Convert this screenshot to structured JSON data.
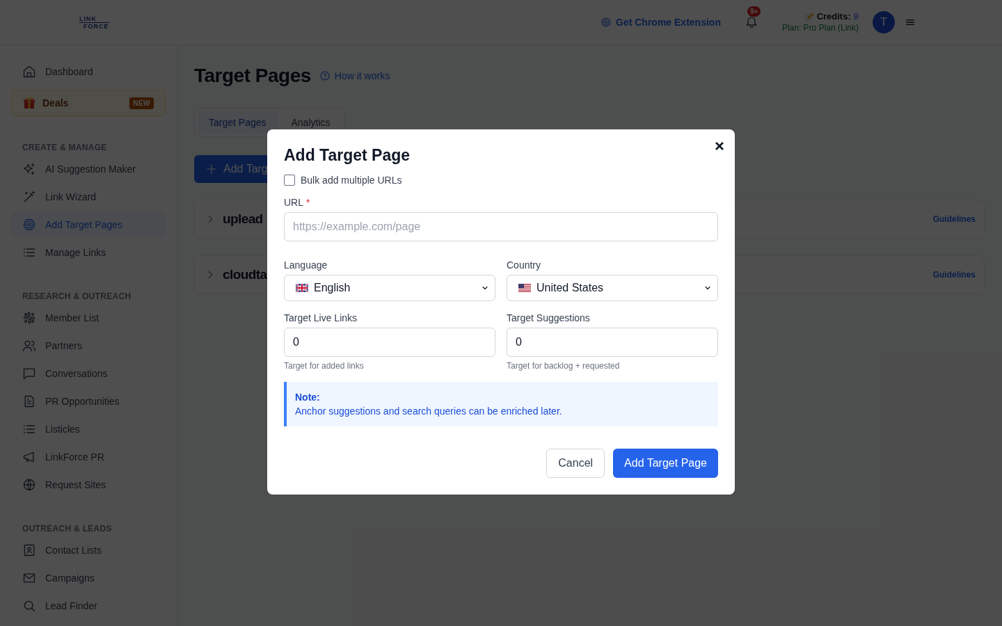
{
  "header": {
    "logo": {
      "line_1": "LINK",
      "line_2": "FORCE"
    },
    "extension_link": "Get Chrome Extension",
    "notifications": {
      "badge": "9+"
    },
    "credits": {
      "label": "Credits:",
      "value": "8"
    },
    "plan": "Plan: Pro Plan (Link)",
    "avatar": "T"
  },
  "sidebar": {
    "dashboard": {
      "label": "Dashboard",
      "selected": false
    },
    "deals": {
      "label": "Deals",
      "badge": "NEW"
    },
    "sections": [
      {
        "title": "CREATE & MANAGE",
        "items": [
          {
            "label": "AI Suggestion Maker",
            "selected": false
          },
          {
            "label": "Link Wizard",
            "selected": false
          },
          {
            "label": "Add Target Pages",
            "selected": true
          },
          {
            "label": "Manage Links",
            "selected": false
          }
        ]
      },
      {
        "title": "RESEARCH & OUTREACH",
        "items": [
          {
            "label": "Member List",
            "selected": false
          },
          {
            "label": "Partners",
            "selected": false
          },
          {
            "label": "Conversations",
            "selected": false
          },
          {
            "label": "PR Opportunities",
            "selected": false
          },
          {
            "label": "Listicles",
            "selected": false
          },
          {
            "label": "LinkForce PR",
            "selected": false
          },
          {
            "label": "Request Sites",
            "selected": false
          }
        ]
      },
      {
        "title": "OUTREACH & LEADS",
        "items": [
          {
            "label": "Contact Lists",
            "selected": false
          },
          {
            "label": "Campaigns",
            "selected": false
          },
          {
            "label": "Lead Finder",
            "selected": false
          }
        ]
      }
    ]
  },
  "page": {
    "title": "Target Pages",
    "help_link": "How it works",
    "tabs": [
      {
        "label": "Target Pages",
        "selected": true
      },
      {
        "label": "Analytics",
        "selected": false
      }
    ],
    "add_button": "Add Targ",
    "rows": [
      {
        "name": "uplead",
        "link": "Guidelines"
      },
      {
        "name": "cloudta",
        "link": "Guidelines"
      }
    ]
  },
  "modal": {
    "title": "Add Target Page",
    "bulk": {
      "label": "Bulk add multiple URLs",
      "checked": false
    },
    "url": {
      "label": "URL",
      "required_mark": "*",
      "placeholder": "https://example.com/page"
    },
    "language": {
      "label": "Language",
      "value": "English"
    },
    "country": {
      "label": "Country",
      "value": "United States"
    },
    "live_links": {
      "label": "Target Live Links",
      "value": "0",
      "hint": "Target for added links"
    },
    "suggestions": {
      "label": "Target Suggestions",
      "value": "0",
      "hint": "Target for backlog + requested"
    },
    "note": {
      "title": "Note:",
      "text": "Anchor suggestions and search queries can be enriched later."
    },
    "buttons": {
      "cancel": "Cancel",
      "submit": "Add Target Page"
    }
  }
}
